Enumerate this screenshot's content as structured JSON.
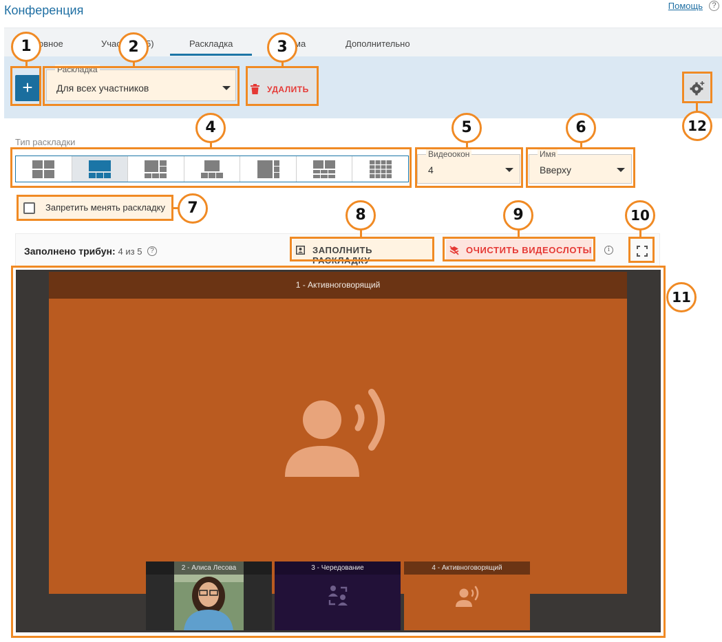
{
  "page": {
    "title": "Конференция",
    "help_label": "Помощь",
    "help_icon": "?"
  },
  "tabs": [
    {
      "label": "овное"
    },
    {
      "label": "Учас"
    },
    {
      "label": "5)"
    },
    {
      "label": "Раскладка",
      "active": true
    },
    {
      "label": "ма"
    },
    {
      "label": "Дополнительно"
    }
  ],
  "toolbar": {
    "add_label": "+",
    "layout_select": {
      "legend": "Раскладка",
      "value": "Для всех участников"
    },
    "delete_label": "УДАЛИТЬ",
    "settings_icon": "gear-plus-icon"
  },
  "layout_type": {
    "label": "Тип раскладки",
    "selected_index": 1,
    "options": [
      "grid-2x2",
      "one-large-three-small",
      "one-plus-side-grid",
      "top-one-bottom-three",
      "large-left-small-right",
      "grid-3x2",
      "grid-4x4"
    ]
  },
  "video_windows": {
    "legend": "Видеоокон",
    "value": "4"
  },
  "name_position": {
    "legend": "Имя",
    "value": "Вверху"
  },
  "lock_layout": {
    "label": "Запретить менять раскладку",
    "checked": false
  },
  "tribunes": {
    "label": "Заполнено трибун:",
    "value": "4 из 5",
    "fill_label": "ЗАПОЛНИТЬ РАСКЛАДКУ",
    "clear_label": "ОЧИСТИТЬ ВИДЕОСЛОТЫ"
  },
  "slots": [
    {
      "label": "1 - Активноговорящий",
      "kind": "active-speaker"
    },
    {
      "label": "2 - Алиса Лесова",
      "kind": "participant"
    },
    {
      "label": "3 - Чередование",
      "kind": "rotation"
    },
    {
      "label": "4 - Активноговорящий",
      "kind": "active-speaker"
    }
  ],
  "callouts": [
    "1",
    "2",
    "3",
    "4",
    "5",
    "6",
    "7",
    "8",
    "9",
    "10",
    "11",
    "12"
  ],
  "colors": {
    "accent": "#1b75a6",
    "highlight": "#f08a24",
    "danger": "#e53935",
    "slot_orange": "#ba5b20"
  }
}
